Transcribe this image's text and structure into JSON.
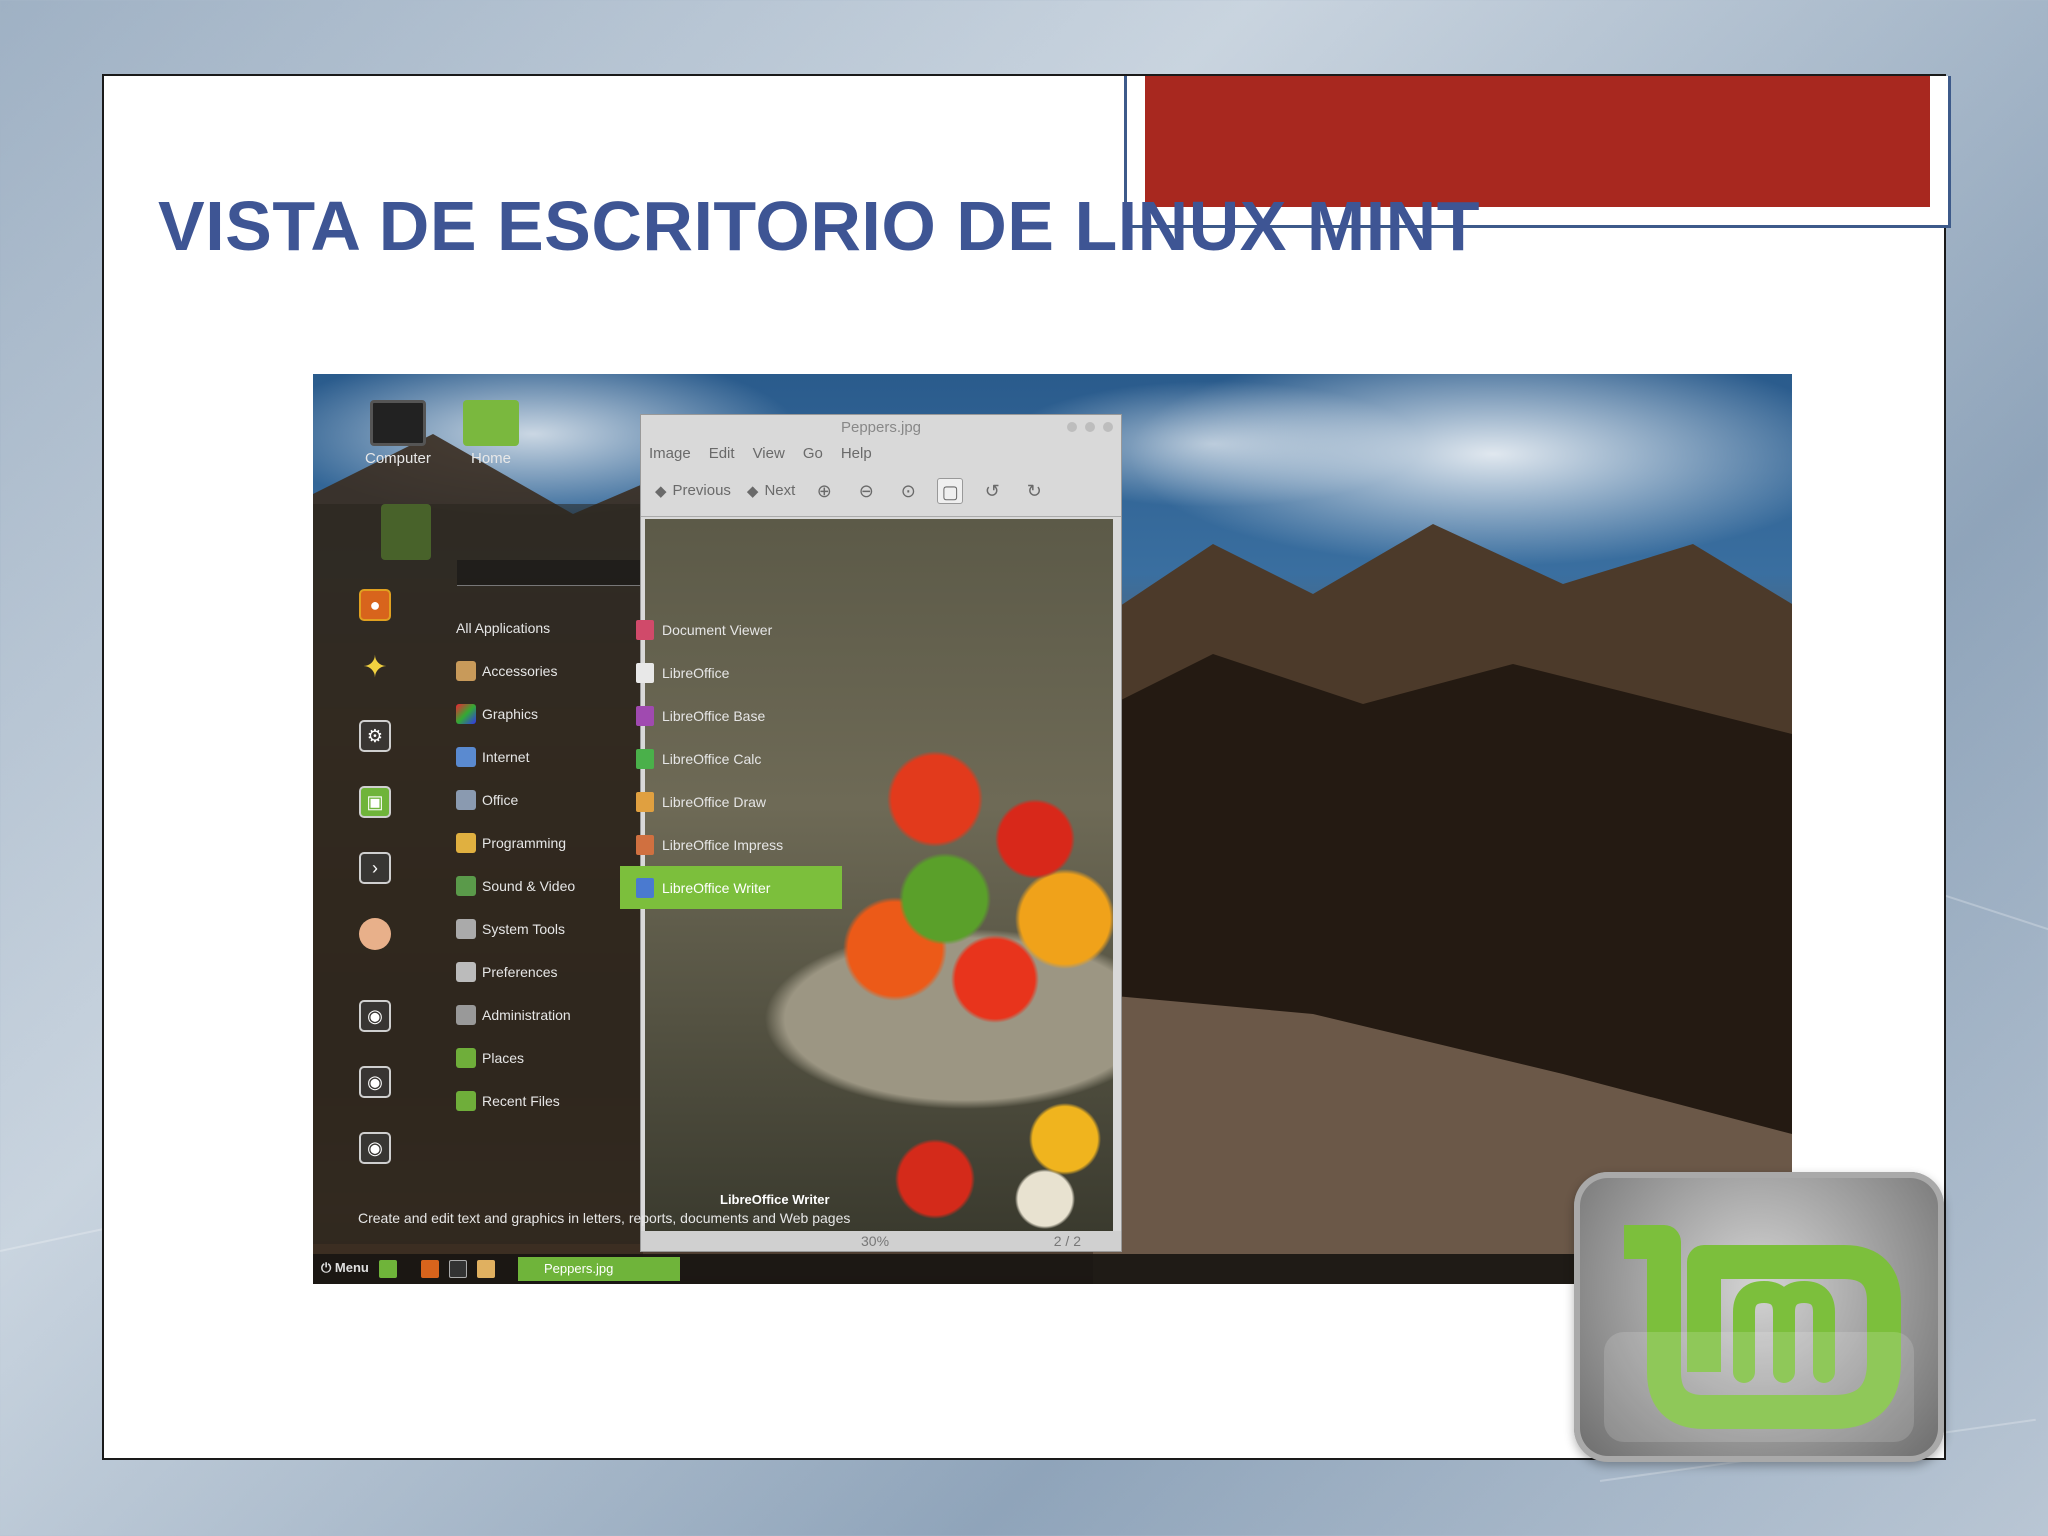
{
  "slide": {
    "title": "VISTA DE ESCRITORIO DE LINUX MINT"
  },
  "desktop_icons": [
    {
      "label": "Computer"
    },
    {
      "label": "Home"
    }
  ],
  "viewer": {
    "title": "Peppers.jpg",
    "menu": [
      "Image",
      "Edit",
      "View",
      "Go",
      "Help"
    ],
    "toolbar": {
      "previous": "Previous",
      "next": "Next"
    },
    "status_zoom": "30%",
    "status_page": "2 / 2"
  },
  "menu": {
    "categories": [
      "All Applications",
      "Accessories",
      "Graphics",
      "Internet",
      "Office",
      "Programming",
      "Sound & Video",
      "System Tools",
      "Preferences",
      "Administration",
      "Places",
      "Recent Files"
    ],
    "apps": [
      "Document Viewer",
      "LibreOffice",
      "LibreOffice Base",
      "LibreOffice Calc",
      "LibreOffice Draw",
      "LibreOffice Impress",
      "LibreOffice Writer"
    ],
    "selected_app": "LibreOffice Writer",
    "description_title": "LibreOffice Writer",
    "description": "Create and edit text and graphics in letters, reports, documents and Web pages"
  },
  "taskbar": {
    "menu_label": "Menu",
    "task_label": "Peppers.jpg"
  },
  "colors": {
    "title_blue": "#3e5594",
    "banner_red": "#a8281f",
    "mint_green": "#7cbf3c"
  }
}
